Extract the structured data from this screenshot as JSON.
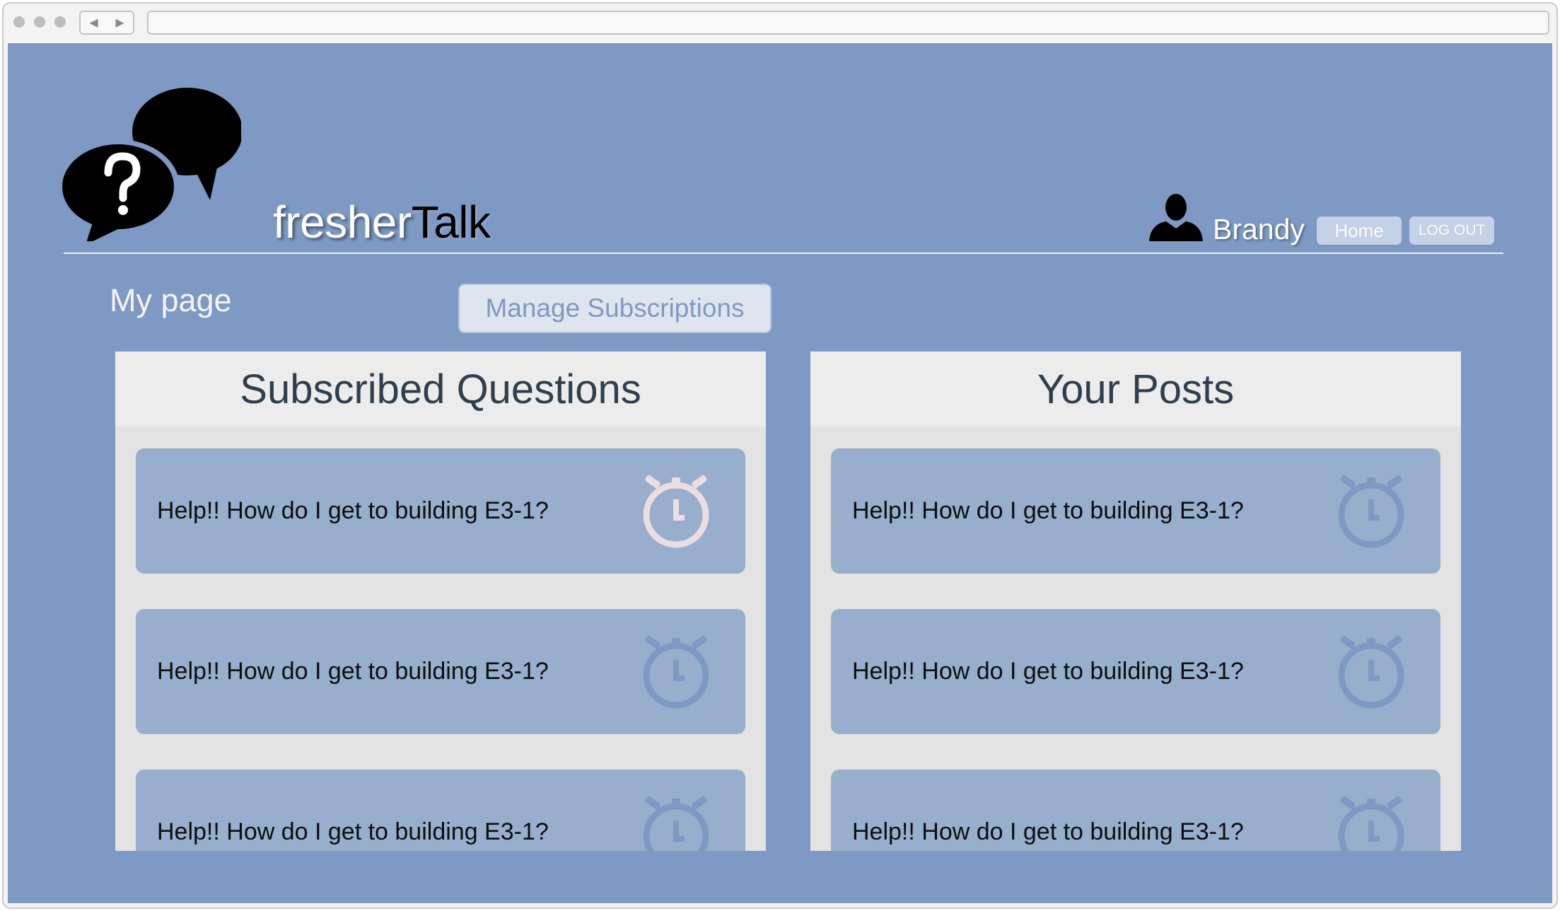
{
  "brand": {
    "part1": "fresher",
    "part2": "Talk"
  },
  "header": {
    "username": "Brandy",
    "home_label": "Home",
    "logout_label": "LOG OUT"
  },
  "page": {
    "title": "My page",
    "manage_label": "Manage Subscriptions"
  },
  "subscribed": {
    "title": "Subscribed Questions",
    "items": [
      {
        "text": "Help!! How do I get to building E3-1?",
        "icon": "stopwatch-icon",
        "icon_color": "#ecdde0"
      },
      {
        "text": "Help!! How do I get to building E3-1?",
        "icon": "stopwatch-icon",
        "icon_color": "#7d99c4"
      },
      {
        "text": "Help!! How do I get to building E3-1?",
        "icon": "stopwatch-icon",
        "icon_color": "#7d99c4"
      }
    ]
  },
  "posts": {
    "title": "Your Posts",
    "items": [
      {
        "text": "Help!! How do I get to building E3-1?",
        "icon": "stopwatch-icon",
        "icon_color": "#7d99c4"
      },
      {
        "text": "Help!! How do I get to building E3-1?",
        "icon": "stopwatch-icon",
        "icon_color": "#7d99c4"
      },
      {
        "text": "Help!! How do I get to building E3-1?",
        "icon": "stopwatch-icon",
        "icon_color": "#7d99c4"
      }
    ]
  },
  "colors": {
    "page_bg": "#7d99c4",
    "card_bg": "#97aecd",
    "panel_bg": "#e3e3e3",
    "heading_text": "#2f3f4d"
  }
}
